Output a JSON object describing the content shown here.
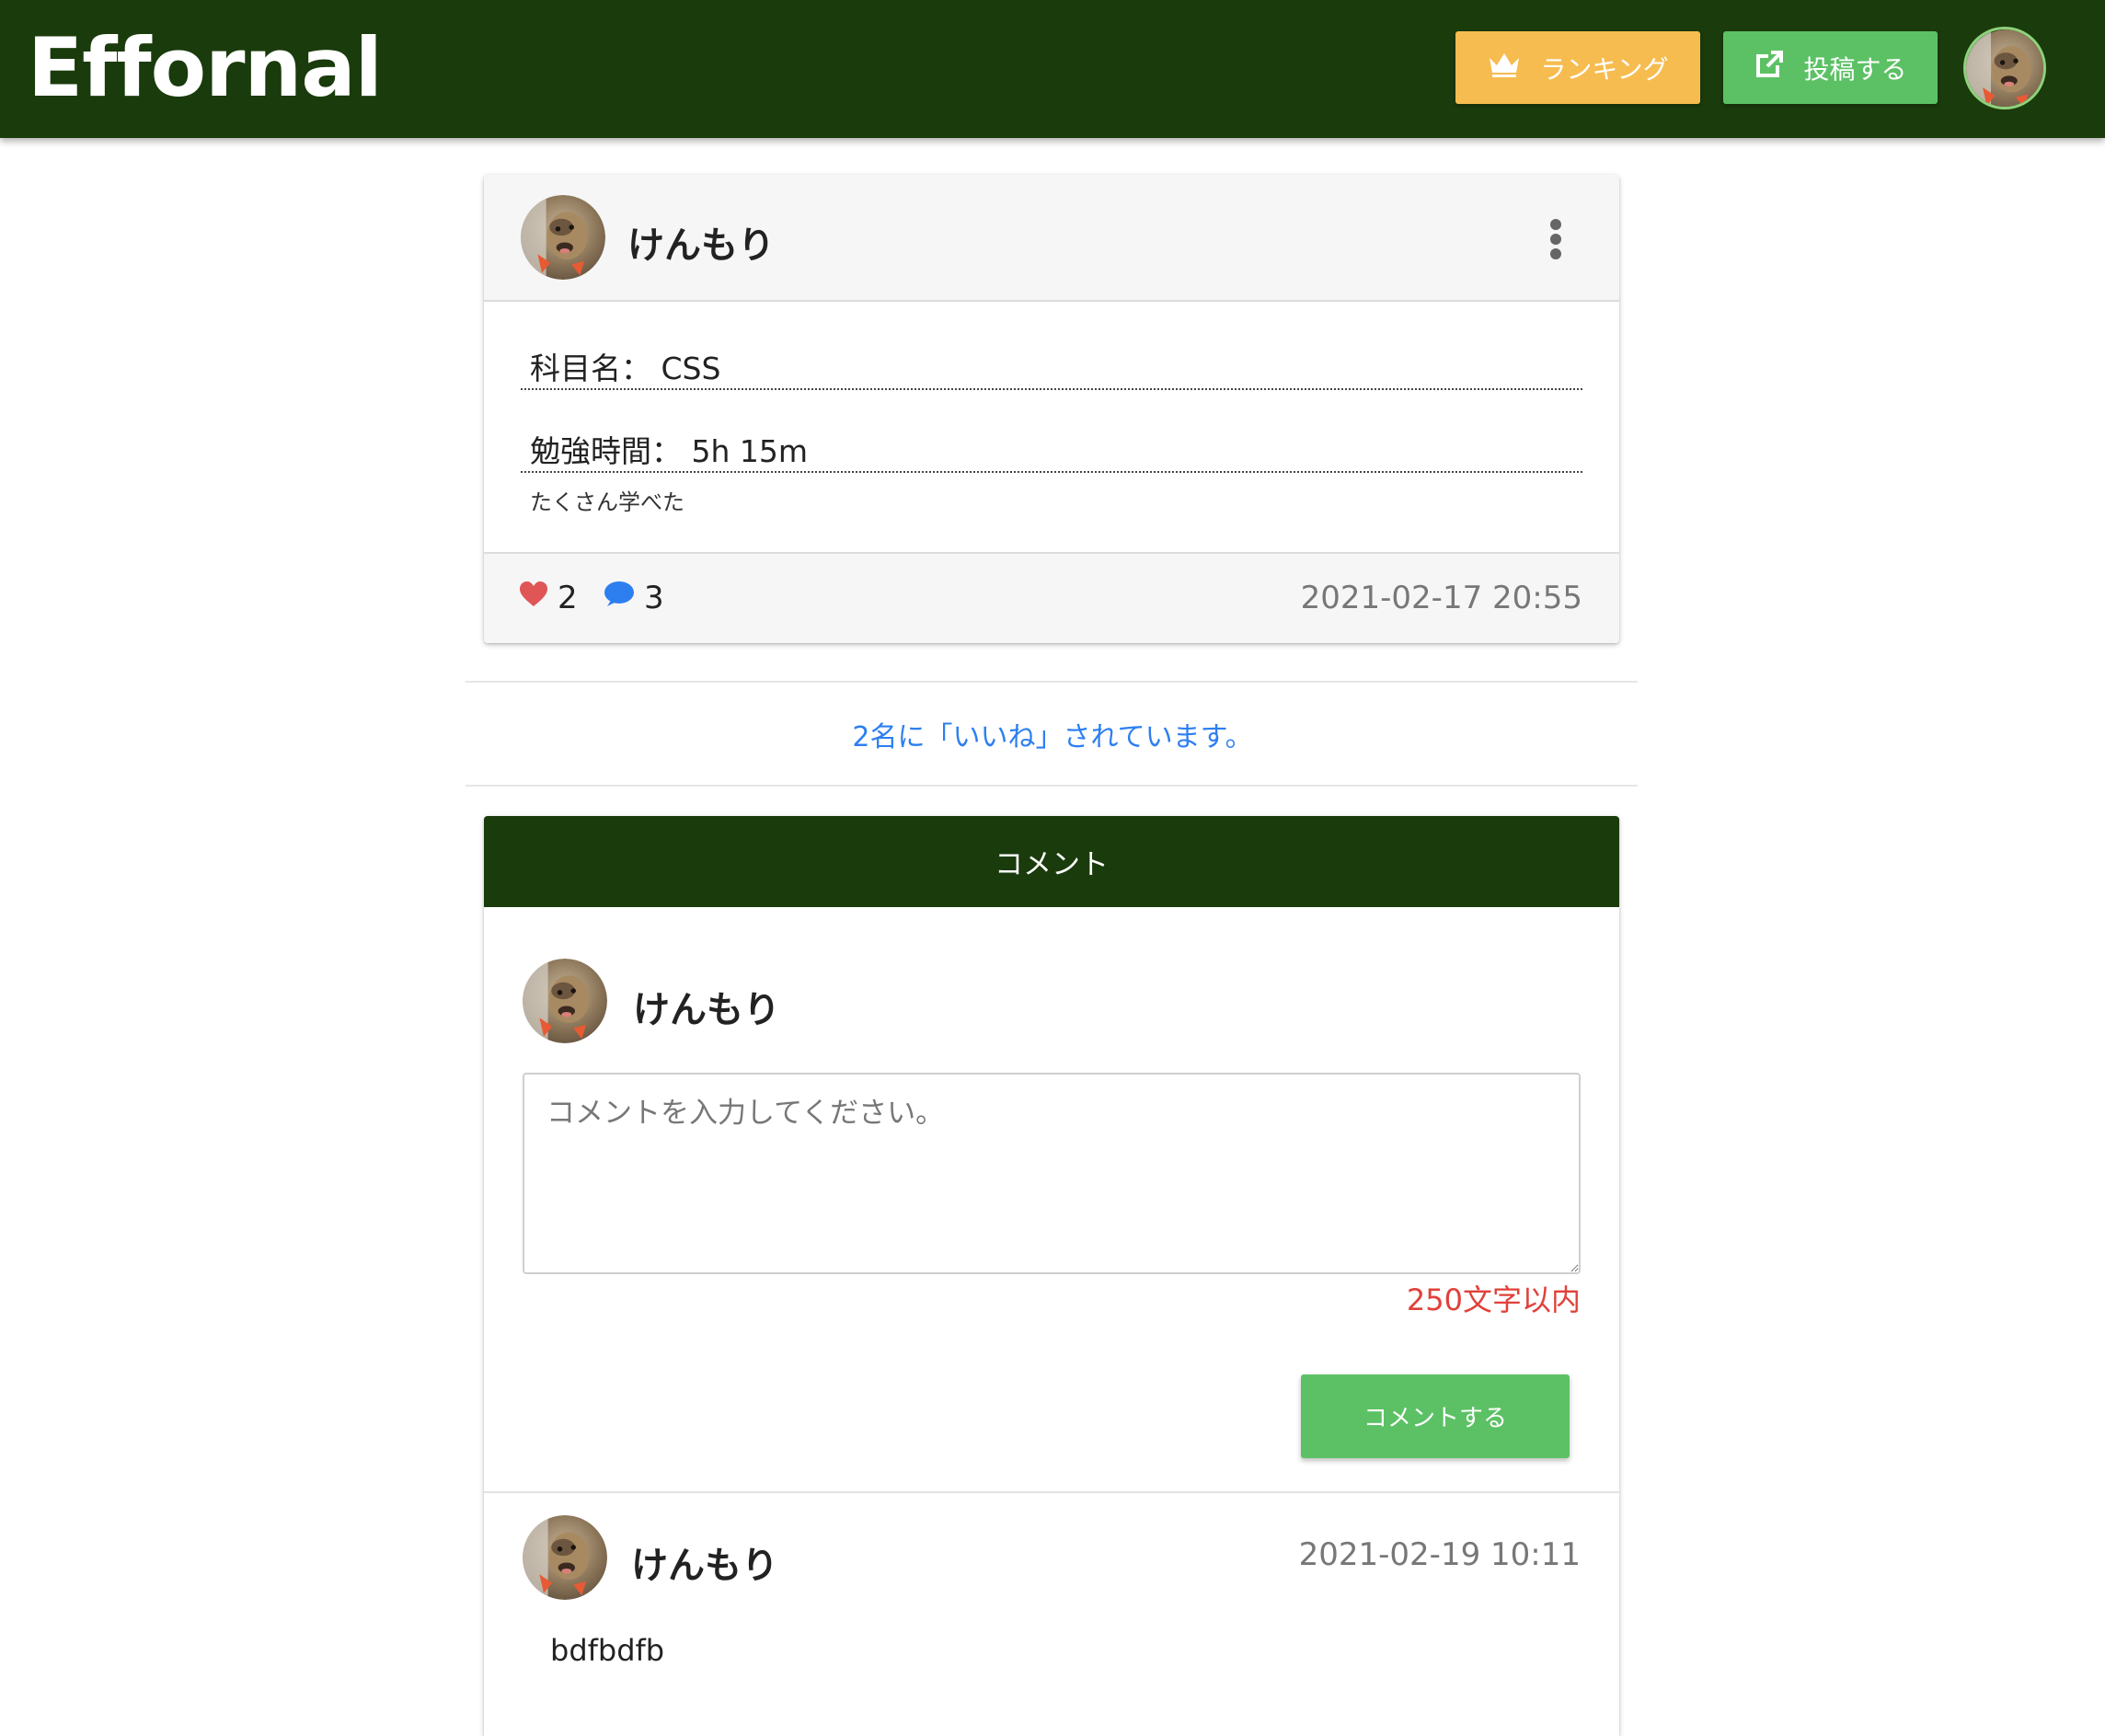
{
  "header": {
    "brand": "Effornal",
    "ranking_label": "ランキング",
    "post_label": "投稿する",
    "icons": {
      "ranking": "crown-icon",
      "post": "external-link-icon",
      "user": "avatar"
    }
  },
  "post": {
    "author": "けんもり",
    "subject_label": "科目名：",
    "subject": "CSS",
    "time_label": "勉強時間：",
    "study_time": "5h 15m",
    "memo": "たくさん学べた",
    "likes": "2",
    "comments": "3",
    "date": "2021-02-17 20:55"
  },
  "likes_text": "2名に「いいね」されています。",
  "comment_section": {
    "title": "コメント",
    "author": "けんもり",
    "placeholder": "コメントを入力してください。",
    "limit_note": "250文字以内",
    "submit_label": "コメントする",
    "items": [
      {
        "author": "けんもり",
        "date": "2021-02-19 10:11",
        "body": "bdfbdfb"
      }
    ]
  },
  "colors": {
    "navbar": "#1a3b0c",
    "ranking_button": "#f6bc4f",
    "post_button": "#5cc165",
    "link": "#2d7ff0",
    "heart": "#e05656",
    "warning": "#e0413a"
  }
}
